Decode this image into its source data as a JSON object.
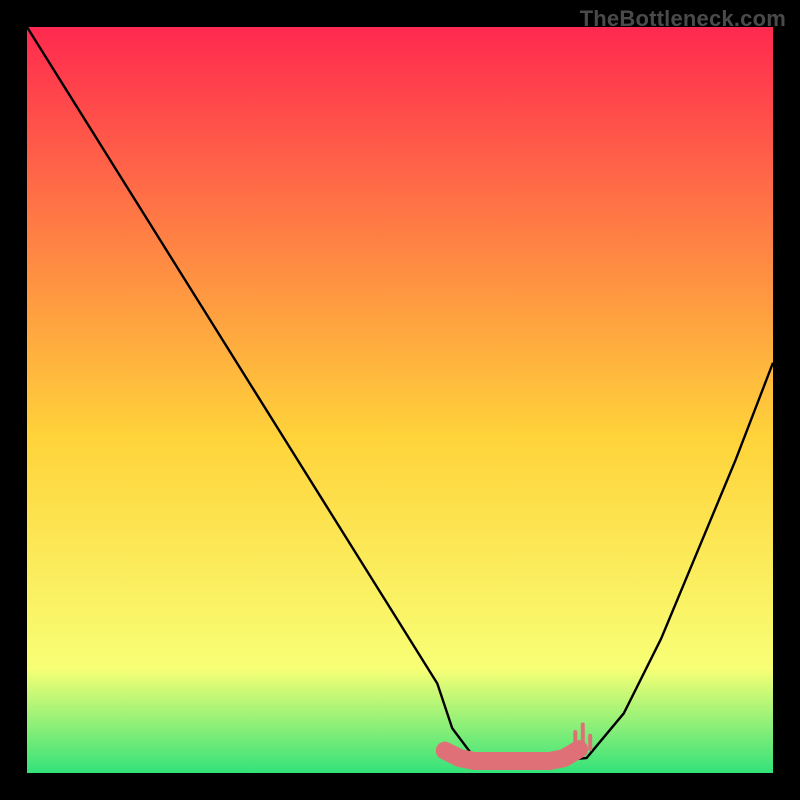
{
  "watermark": "TheBottleneck.com",
  "chart_data": {
    "type": "line",
    "title": "",
    "xlabel": "",
    "ylabel": "",
    "xlim": [
      0,
      100
    ],
    "ylim": [
      0,
      100
    ],
    "background_gradient": {
      "top_color": "#ff294f",
      "mid_color": "#ffd33a",
      "near_bottom_color": "#f8ff75",
      "bottom_color": "#33e27a"
    },
    "series": [
      {
        "name": "bottleneck-curve",
        "color": "#000000",
        "x": [
          0,
          5,
          10,
          15,
          20,
          25,
          30,
          35,
          40,
          45,
          50,
          55,
          57,
          60,
          63,
          66,
          70,
          75,
          80,
          85,
          90,
          95,
          100
        ],
        "y": [
          100,
          92,
          84,
          76,
          68,
          60,
          52,
          44,
          36,
          28,
          20,
          12,
          6,
          2,
          1.6,
          1.6,
          1.6,
          2,
          8,
          18,
          30,
          42,
          55
        ]
      }
    ],
    "accent": {
      "color": "#e07078",
      "x": [
        56,
        58,
        60,
        62,
        64,
        66,
        68,
        70,
        72,
        74
      ],
      "y": [
        3,
        2,
        1.6,
        1.6,
        1.6,
        1.6,
        1.6,
        1.6,
        2,
        3.2
      ]
    },
    "accent_spikes": {
      "color": "#e07078",
      "items": [
        {
          "x": 73.5,
          "y0": 3.2,
          "y1": 5.5
        },
        {
          "x": 74.5,
          "y0": 3.2,
          "y1": 6.5
        },
        {
          "x": 75.5,
          "y0": 3.2,
          "y1": 5.0
        }
      ]
    }
  }
}
